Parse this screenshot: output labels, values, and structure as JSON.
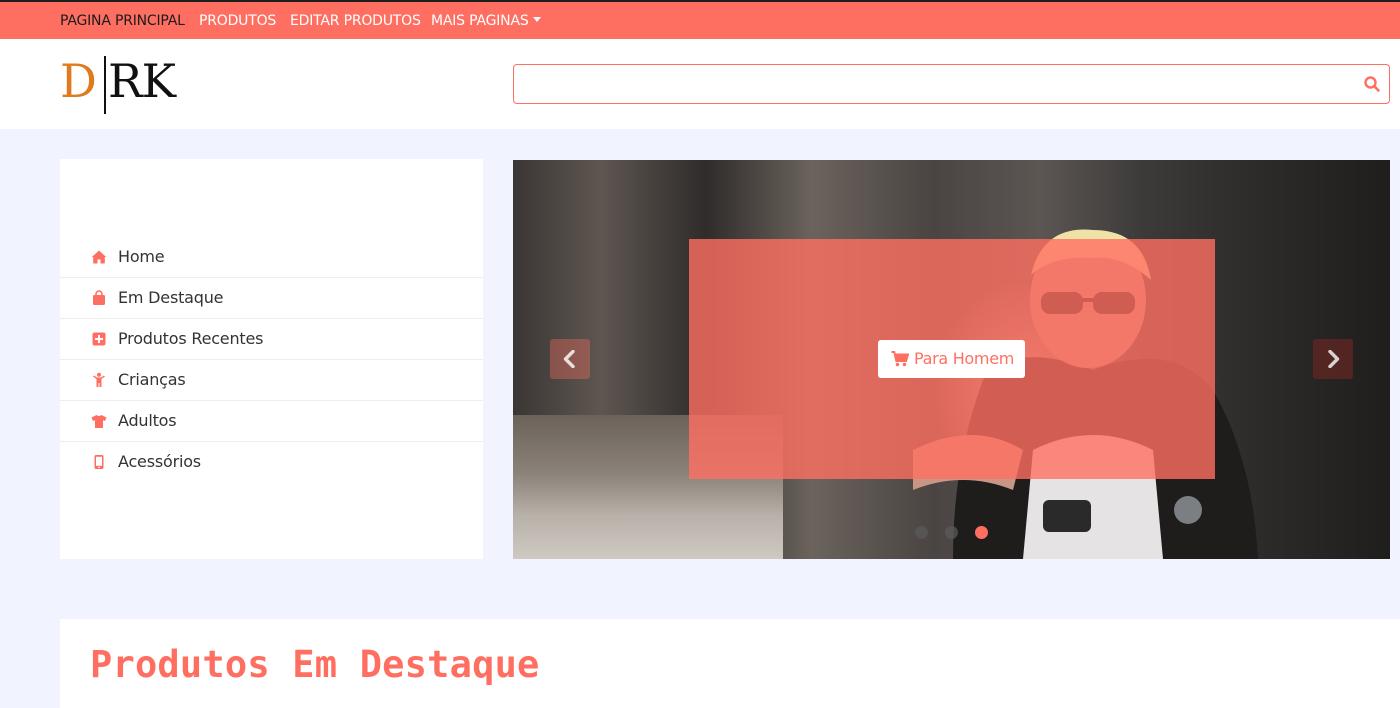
{
  "nav": {
    "items": [
      {
        "label": "PAGINA PRINCIPAL",
        "active": true
      },
      {
        "label": "PRODUTOS",
        "active": false
      },
      {
        "label": "EDITAR PRODUTOS",
        "active": false
      },
      {
        "label": "MAIS PAGINAS",
        "active": false,
        "dropdown": true
      }
    ]
  },
  "header": {
    "logo": {
      "letter1": "D",
      "letters2": "RK"
    },
    "search": {
      "placeholder": "",
      "value": "",
      "icon": "search-icon"
    }
  },
  "sidebar": {
    "items": [
      {
        "label": "Home",
        "icon": "home-icon"
      },
      {
        "label": "Em Destaque",
        "icon": "shopping-bag-icon"
      },
      {
        "label": "Produtos Recentes",
        "icon": "plus-square-icon"
      },
      {
        "label": "Crianças",
        "icon": "child-icon"
      },
      {
        "label": "Adultos",
        "icon": "tshirt-icon"
      },
      {
        "label": "Acessórios",
        "icon": "mobile-icon"
      }
    ]
  },
  "carousel": {
    "cta_label": "Para Homem",
    "cta_icon": "cart-icon",
    "slide_count": 3,
    "active_slide": 3
  },
  "featured": {
    "title": "Produtos Em Destaque"
  },
  "colors": {
    "accent": "#ff6f61",
    "background": "#f1f4fe",
    "logo_orange": "#e07a1f"
  }
}
